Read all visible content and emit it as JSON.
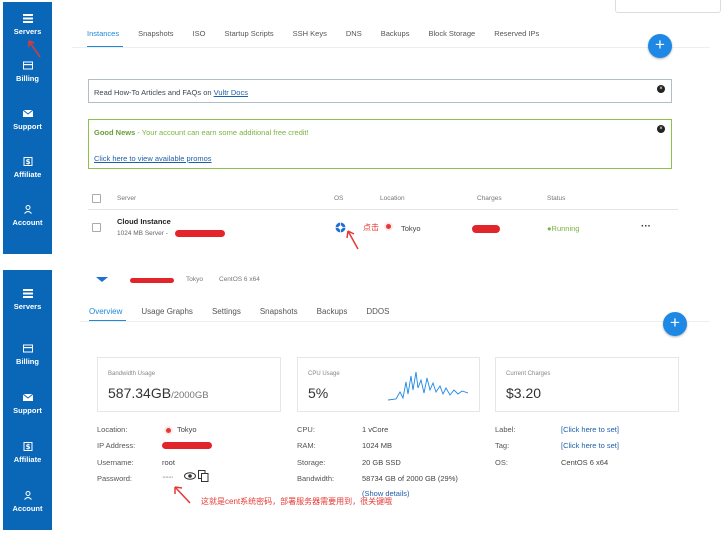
{
  "sidebar": {
    "items": [
      {
        "label": "Servers",
        "icon": "server-icon"
      },
      {
        "label": "Billing",
        "icon": "billing-card-icon"
      },
      {
        "label": "Support",
        "icon": "mail-icon"
      },
      {
        "label": "Affiliate",
        "icon": "dollar-icon"
      },
      {
        "label": "Account",
        "icon": "user-icon"
      }
    ]
  },
  "top": {
    "tabs": [
      "Instances",
      "Snapshots",
      "ISO",
      "Startup Scripts",
      "SSH Keys",
      "DNS",
      "Backups",
      "Block Storage",
      "Reserved IPs"
    ],
    "plus_label": "+",
    "info_notice": {
      "prefix": "Read How-To Articles and FAQs on ",
      "link": "Vultr Docs"
    },
    "good_notice": {
      "title": "Good News",
      "text": " - Your account can earn some additional free credit!",
      "link": "Click here to view available promos"
    },
    "close_label": "×",
    "table_headers": {
      "server": "Server",
      "os": "OS",
      "location": "Location",
      "charges": "Charges",
      "status": "Status"
    },
    "row": {
      "name": "Cloud Instance",
      "sub": "1024 MB Server -",
      "location": "Tokyo",
      "status": "Running",
      "menu": "···",
      "annotation": "点击"
    }
  },
  "bottom": {
    "crumb": {
      "location": "Tokyo",
      "os": "CentOS 6 x64"
    },
    "tabs": [
      "Overview",
      "Usage Graphs",
      "Settings",
      "Snapshots",
      "Backups",
      "DDOS"
    ],
    "plus_label": "+",
    "cards": {
      "bandwidth": {
        "label": "Bandwidth Usage",
        "value": "587.34GB",
        "total": "/2000GB"
      },
      "cpu": {
        "label": "CPU Usage",
        "value": "5%"
      },
      "charges": {
        "label": "Current Charges",
        "value": "$3.20"
      }
    },
    "details": {
      "location_k": "Location:",
      "location_v": "Tokyo",
      "ip_k": "IP Address:",
      "username_k": "Username:",
      "username_v": "root",
      "password_k": "Password:",
      "password_v": "·······",
      "cpu_k": "CPU:",
      "cpu_v": "1 vCore",
      "ram_k": "RAM:",
      "ram_v": "1024 MB",
      "storage_k": "Storage:",
      "storage_v": "20 GB SSD",
      "bw_k": "Bandwidth:",
      "bw_v": "58734 GB of 2000 GB (29%)",
      "show_details": "(Show details)",
      "label_k": "Label:",
      "label_v": "[Click here to set]",
      "tag_k": "Tag:",
      "tag_v": "[Click here to set]",
      "os_k": "OS:",
      "os_v": "CentOS 6 x64"
    },
    "annotation": "这就是cent系统密码，部署服务器需要用到，很关键哦"
  },
  "colors": {
    "sidebar": "#0a67b8",
    "accent": "#1e88e5",
    "annotation": "#e53935",
    "good": "#7cb342"
  }
}
